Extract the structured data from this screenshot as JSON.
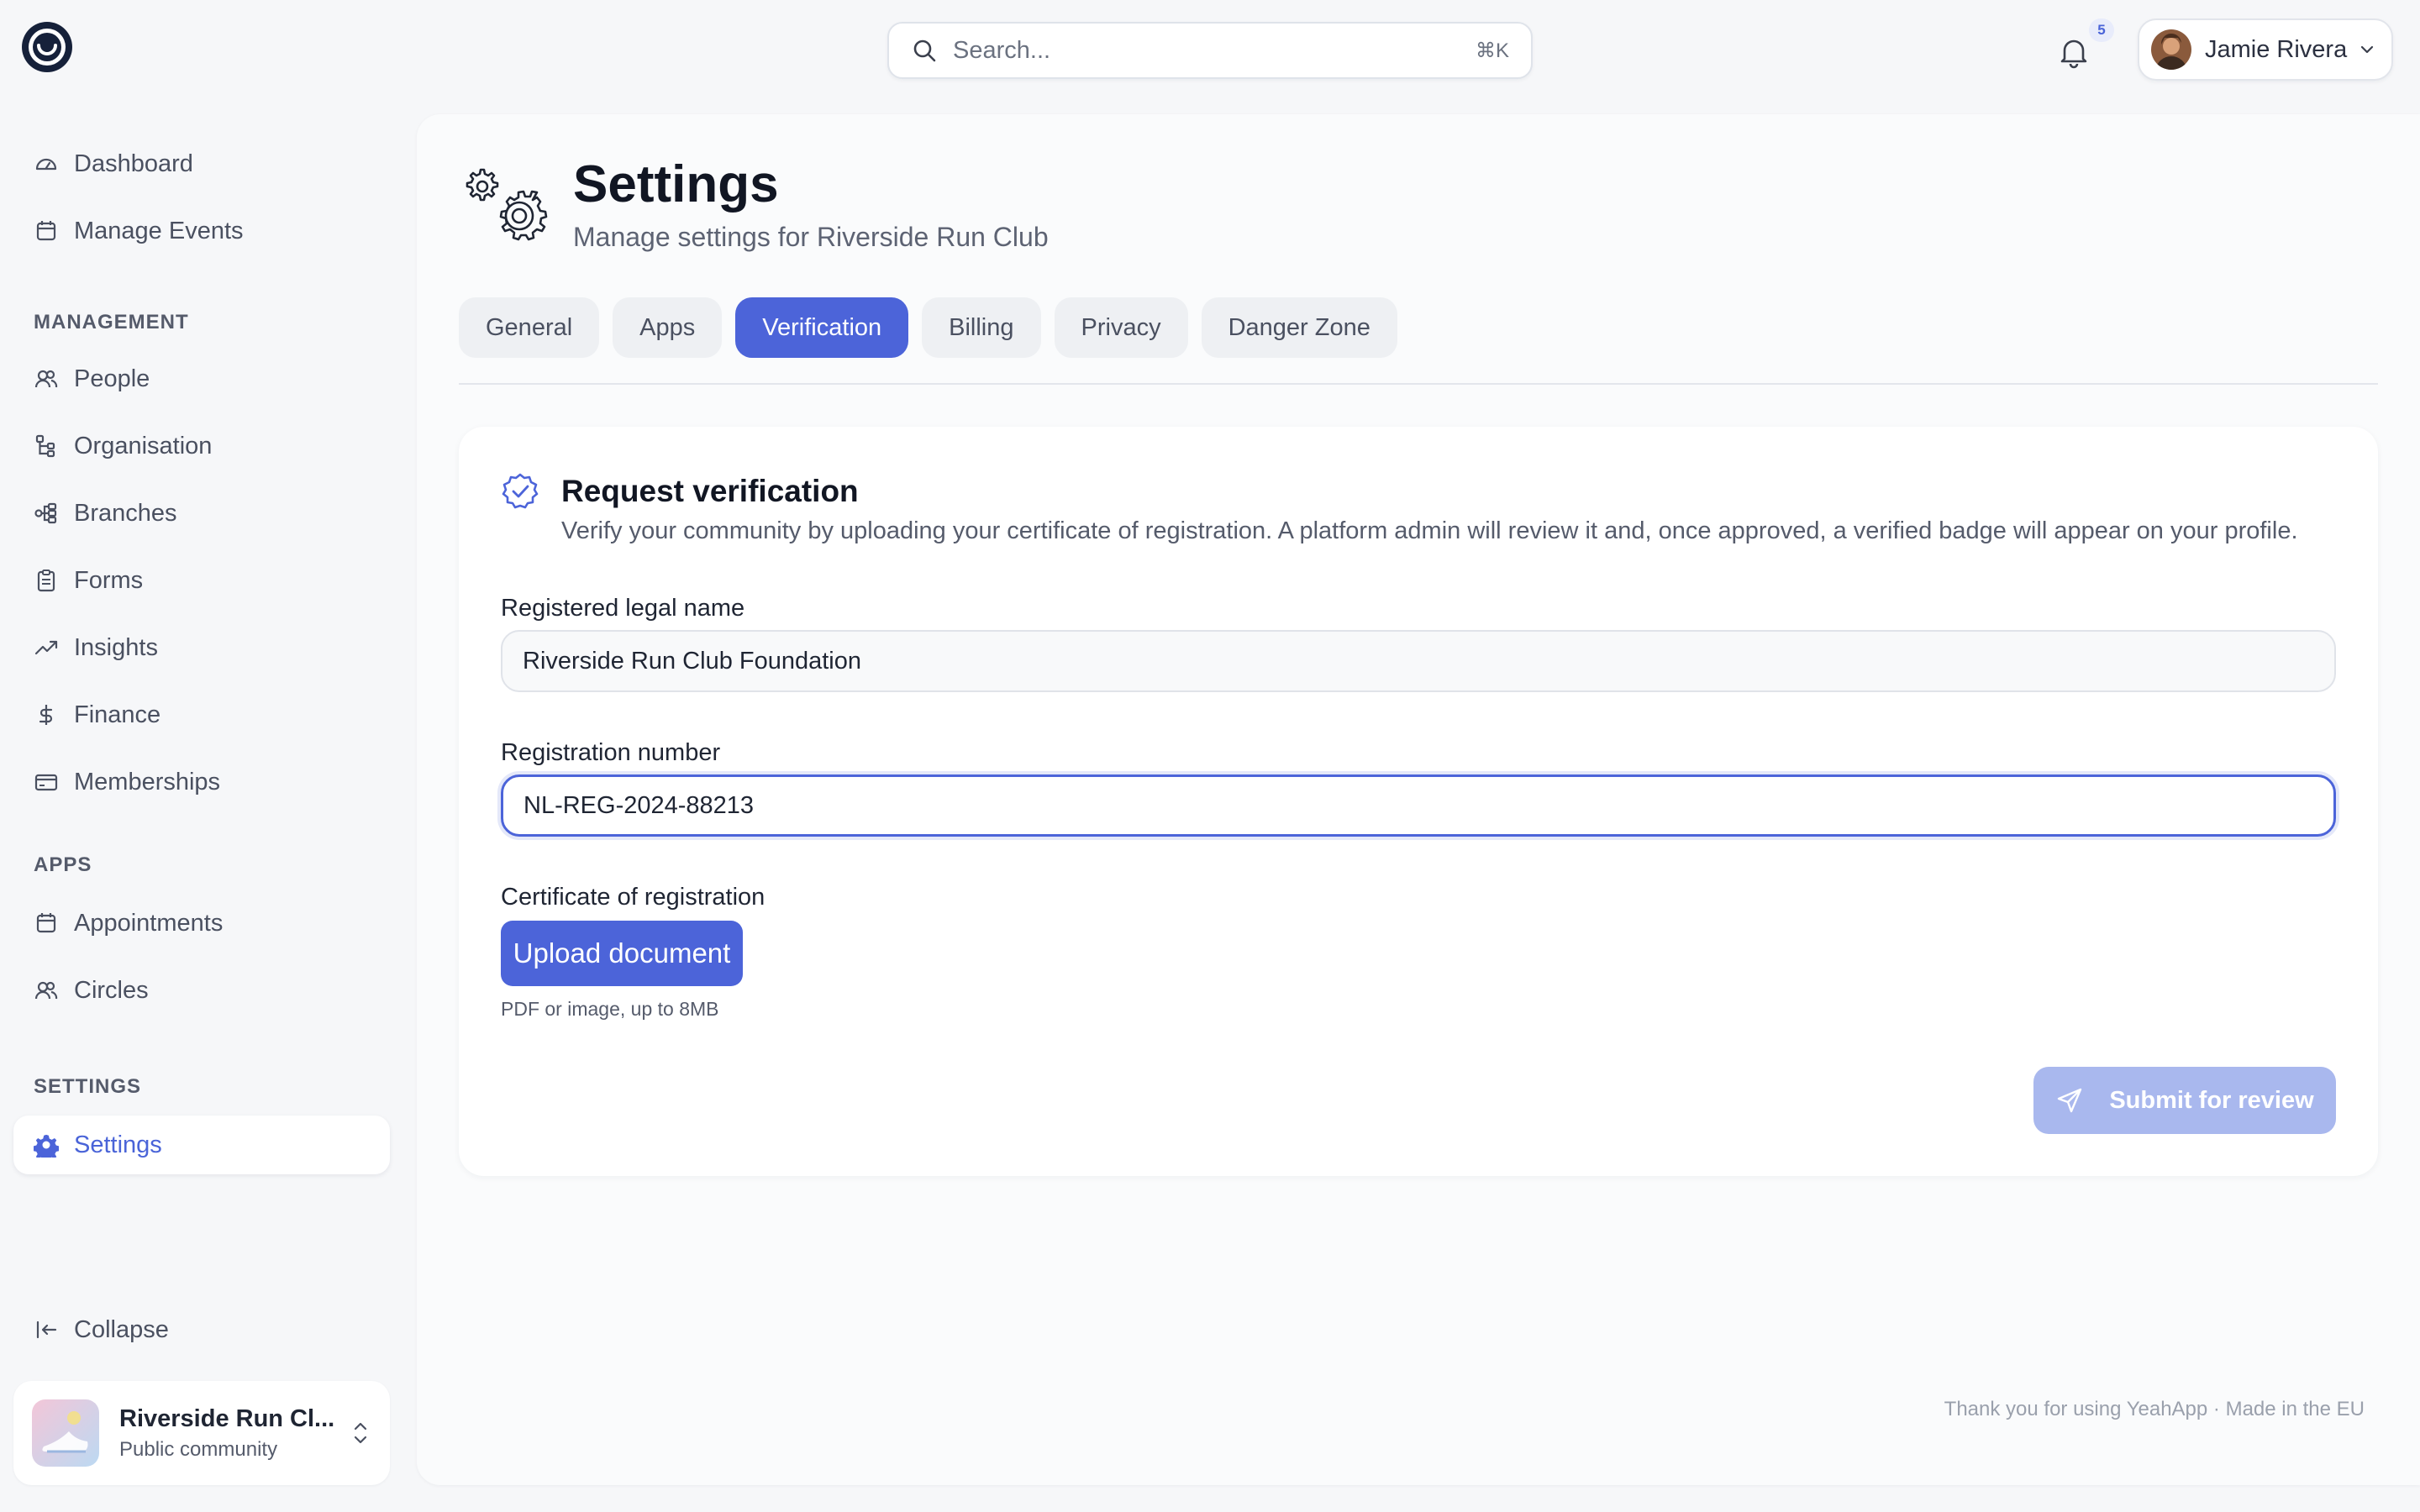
{
  "header": {
    "search_placeholder": "Search...",
    "search_shortcut": "⌘K",
    "notification_count": "5",
    "user_name": "Jamie Rivera"
  },
  "sidebar": {
    "top_items": [
      {
        "label": "Dashboard",
        "icon": "dashboard-icon"
      },
      {
        "label": "Manage Events",
        "icon": "calendar-icon"
      }
    ],
    "management_label": "MANAGEMENT",
    "management_items": [
      {
        "label": "People",
        "icon": "people-icon"
      },
      {
        "label": "Organisation",
        "icon": "org-tree-icon"
      },
      {
        "label": "Branches",
        "icon": "branches-icon"
      },
      {
        "label": "Forms",
        "icon": "clipboard-icon"
      },
      {
        "label": "Insights",
        "icon": "trending-up-icon"
      },
      {
        "label": "Finance",
        "icon": "dollar-icon"
      },
      {
        "label": "Memberships",
        "icon": "card-icon"
      }
    ],
    "apps_label": "APPS",
    "apps_items": [
      {
        "label": "Appointments",
        "icon": "calendar-icon"
      },
      {
        "label": "Circles",
        "icon": "people-icon"
      }
    ],
    "settings_label": "SETTINGS",
    "settings_item": {
      "label": "Settings",
      "icon": "gear-icon"
    },
    "collapse_label": "Collapse",
    "org": {
      "name": "Riverside Run Cl...",
      "type": "Public community"
    }
  },
  "page": {
    "title": "Settings",
    "subtitle": "Manage settings for Riverside Run Club",
    "tabs": [
      "General",
      "Apps",
      "Verification",
      "Billing",
      "Privacy",
      "Danger Zone"
    ],
    "active_tab": "Verification"
  },
  "verification": {
    "title": "Request verification",
    "description": "Verify your community by uploading your certificate of registration. A platform admin will review it and, once approved, a verified badge will appear on your profile.",
    "legal_name_label": "Registered legal name",
    "legal_name_value": "Riverside Run Club Foundation",
    "reg_number_label": "Registration number",
    "reg_number_value": "NL-REG-2024-88213",
    "certificate_label": "Certificate of registration",
    "upload_label": "Upload document",
    "upload_hint": "PDF or image, up to 8MB",
    "submit_label": "Submit for review"
  },
  "footer": {
    "note": "Thank you for using YeahApp · Made in the EU"
  },
  "colors": {
    "accent": "#4c64d9",
    "accent_disabled": "#a9b8ee",
    "background": "#f6f7f9"
  }
}
